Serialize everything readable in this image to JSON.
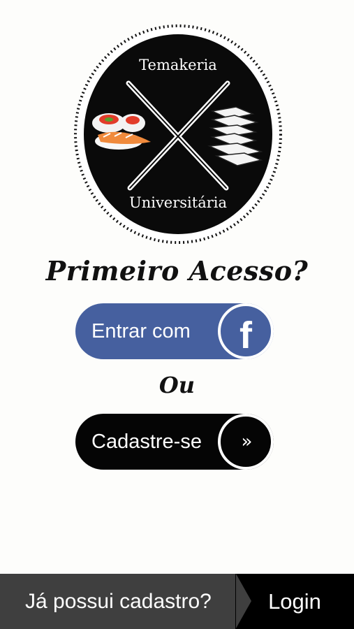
{
  "logo": {
    "top_text": "Temakeria",
    "bottom_text": "Universitária"
  },
  "heading": "Primeiro Acesso?",
  "facebook_button": {
    "label": "Entrar com",
    "icon": "facebook-icon",
    "color": "#46609f"
  },
  "separator": "Ou",
  "register_button": {
    "label": "Cadastre-se",
    "icon": "double-chevron-right-icon",
    "glyph": "»",
    "color": "#050505"
  },
  "bottom_bar": {
    "question": "Já possui cadastro?",
    "login_label": "Login",
    "color": "#3f3f3f"
  }
}
